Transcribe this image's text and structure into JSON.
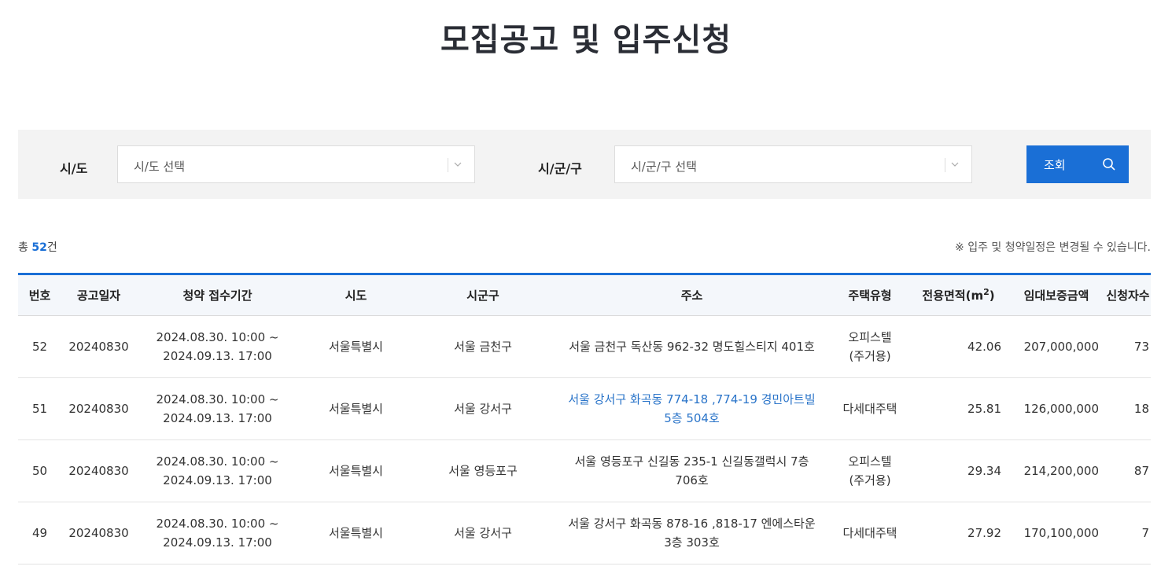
{
  "page": {
    "title": "모집공고 및 입주신청"
  },
  "search": {
    "sido_label": "시/도",
    "sido_placeholder": "시/도 선택",
    "sigungu_label": "시/군/구",
    "sigungu_placeholder": "시/군/구 선택",
    "button_label": "조회"
  },
  "summary": {
    "total_prefix": "총",
    "total_count": "52",
    "total_suffix": "건",
    "notice": "※ 입주 및 청약일정은 변경될 수 있습니다."
  },
  "table": {
    "headers": {
      "no": "번호",
      "date": "공고일자",
      "period": "청약 접수기간",
      "sido": "시도",
      "sigungu": "시군구",
      "address": "주소",
      "type": "주택유형",
      "area": "전용면적(m",
      "area_sup": "2",
      "area_close": ")",
      "deposit": "임대보증금액",
      "applicants": "신청자수"
    },
    "rows": [
      {
        "no": "52",
        "date": "20240830",
        "period_start": "2024.08.30. 10:00 ~",
        "period_end": "2024.09.13. 17:00",
        "sido": "서울특별시",
        "sigungu": "서울 금천구",
        "address_line1": "서울 금천구 독산동 962-32 명도힐스티지 401호",
        "address_line2": "",
        "type_line1": "오피스텔",
        "type_line2": "(주거용)",
        "area": "42.06",
        "deposit": "207,000,000",
        "applicants": "73"
      },
      {
        "no": "51",
        "date": "20240830",
        "period_start": "2024.08.30. 10:00 ~",
        "period_end": "2024.09.13. 17:00",
        "sido": "서울특별시",
        "sigungu": "서울 강서구",
        "address_line1": "서울 강서구 화곡동 774-18 ,774-19 경민아트빌",
        "address_line2": "5층 504호",
        "type_line1": "다세대주택",
        "type_line2": "",
        "area": "25.81",
        "deposit": "126,000,000",
        "applicants": "18"
      },
      {
        "no": "50",
        "date": "20240830",
        "period_start": "2024.08.30. 10:00 ~",
        "period_end": "2024.09.13. 17:00",
        "sido": "서울특별시",
        "sigungu": "서울 영등포구",
        "address_line1": "서울 영등포구 신길동 235-1 신길동갤럭시 7층",
        "address_line2": "706호",
        "type_line1": "오피스텔",
        "type_line2": "(주거용)",
        "area": "29.34",
        "deposit": "214,200,000",
        "applicants": "87"
      },
      {
        "no": "49",
        "date": "20240830",
        "period_start": "2024.08.30. 10:00 ~",
        "period_end": "2024.09.13. 17:00",
        "sido": "서울특별시",
        "sigungu": "서울 강서구",
        "address_line1": "서울 강서구 화곡동 878-16 ,818-17 엔에스타운",
        "address_line2": "3층 303호",
        "type_line1": "다세대주택",
        "type_line2": "",
        "area": "27.92",
        "deposit": "170,100,000",
        "applicants": "7"
      }
    ]
  },
  "colors": {
    "accent": "#1a6fd6",
    "link": "#2a74c9",
    "title": "#2a2d35"
  }
}
